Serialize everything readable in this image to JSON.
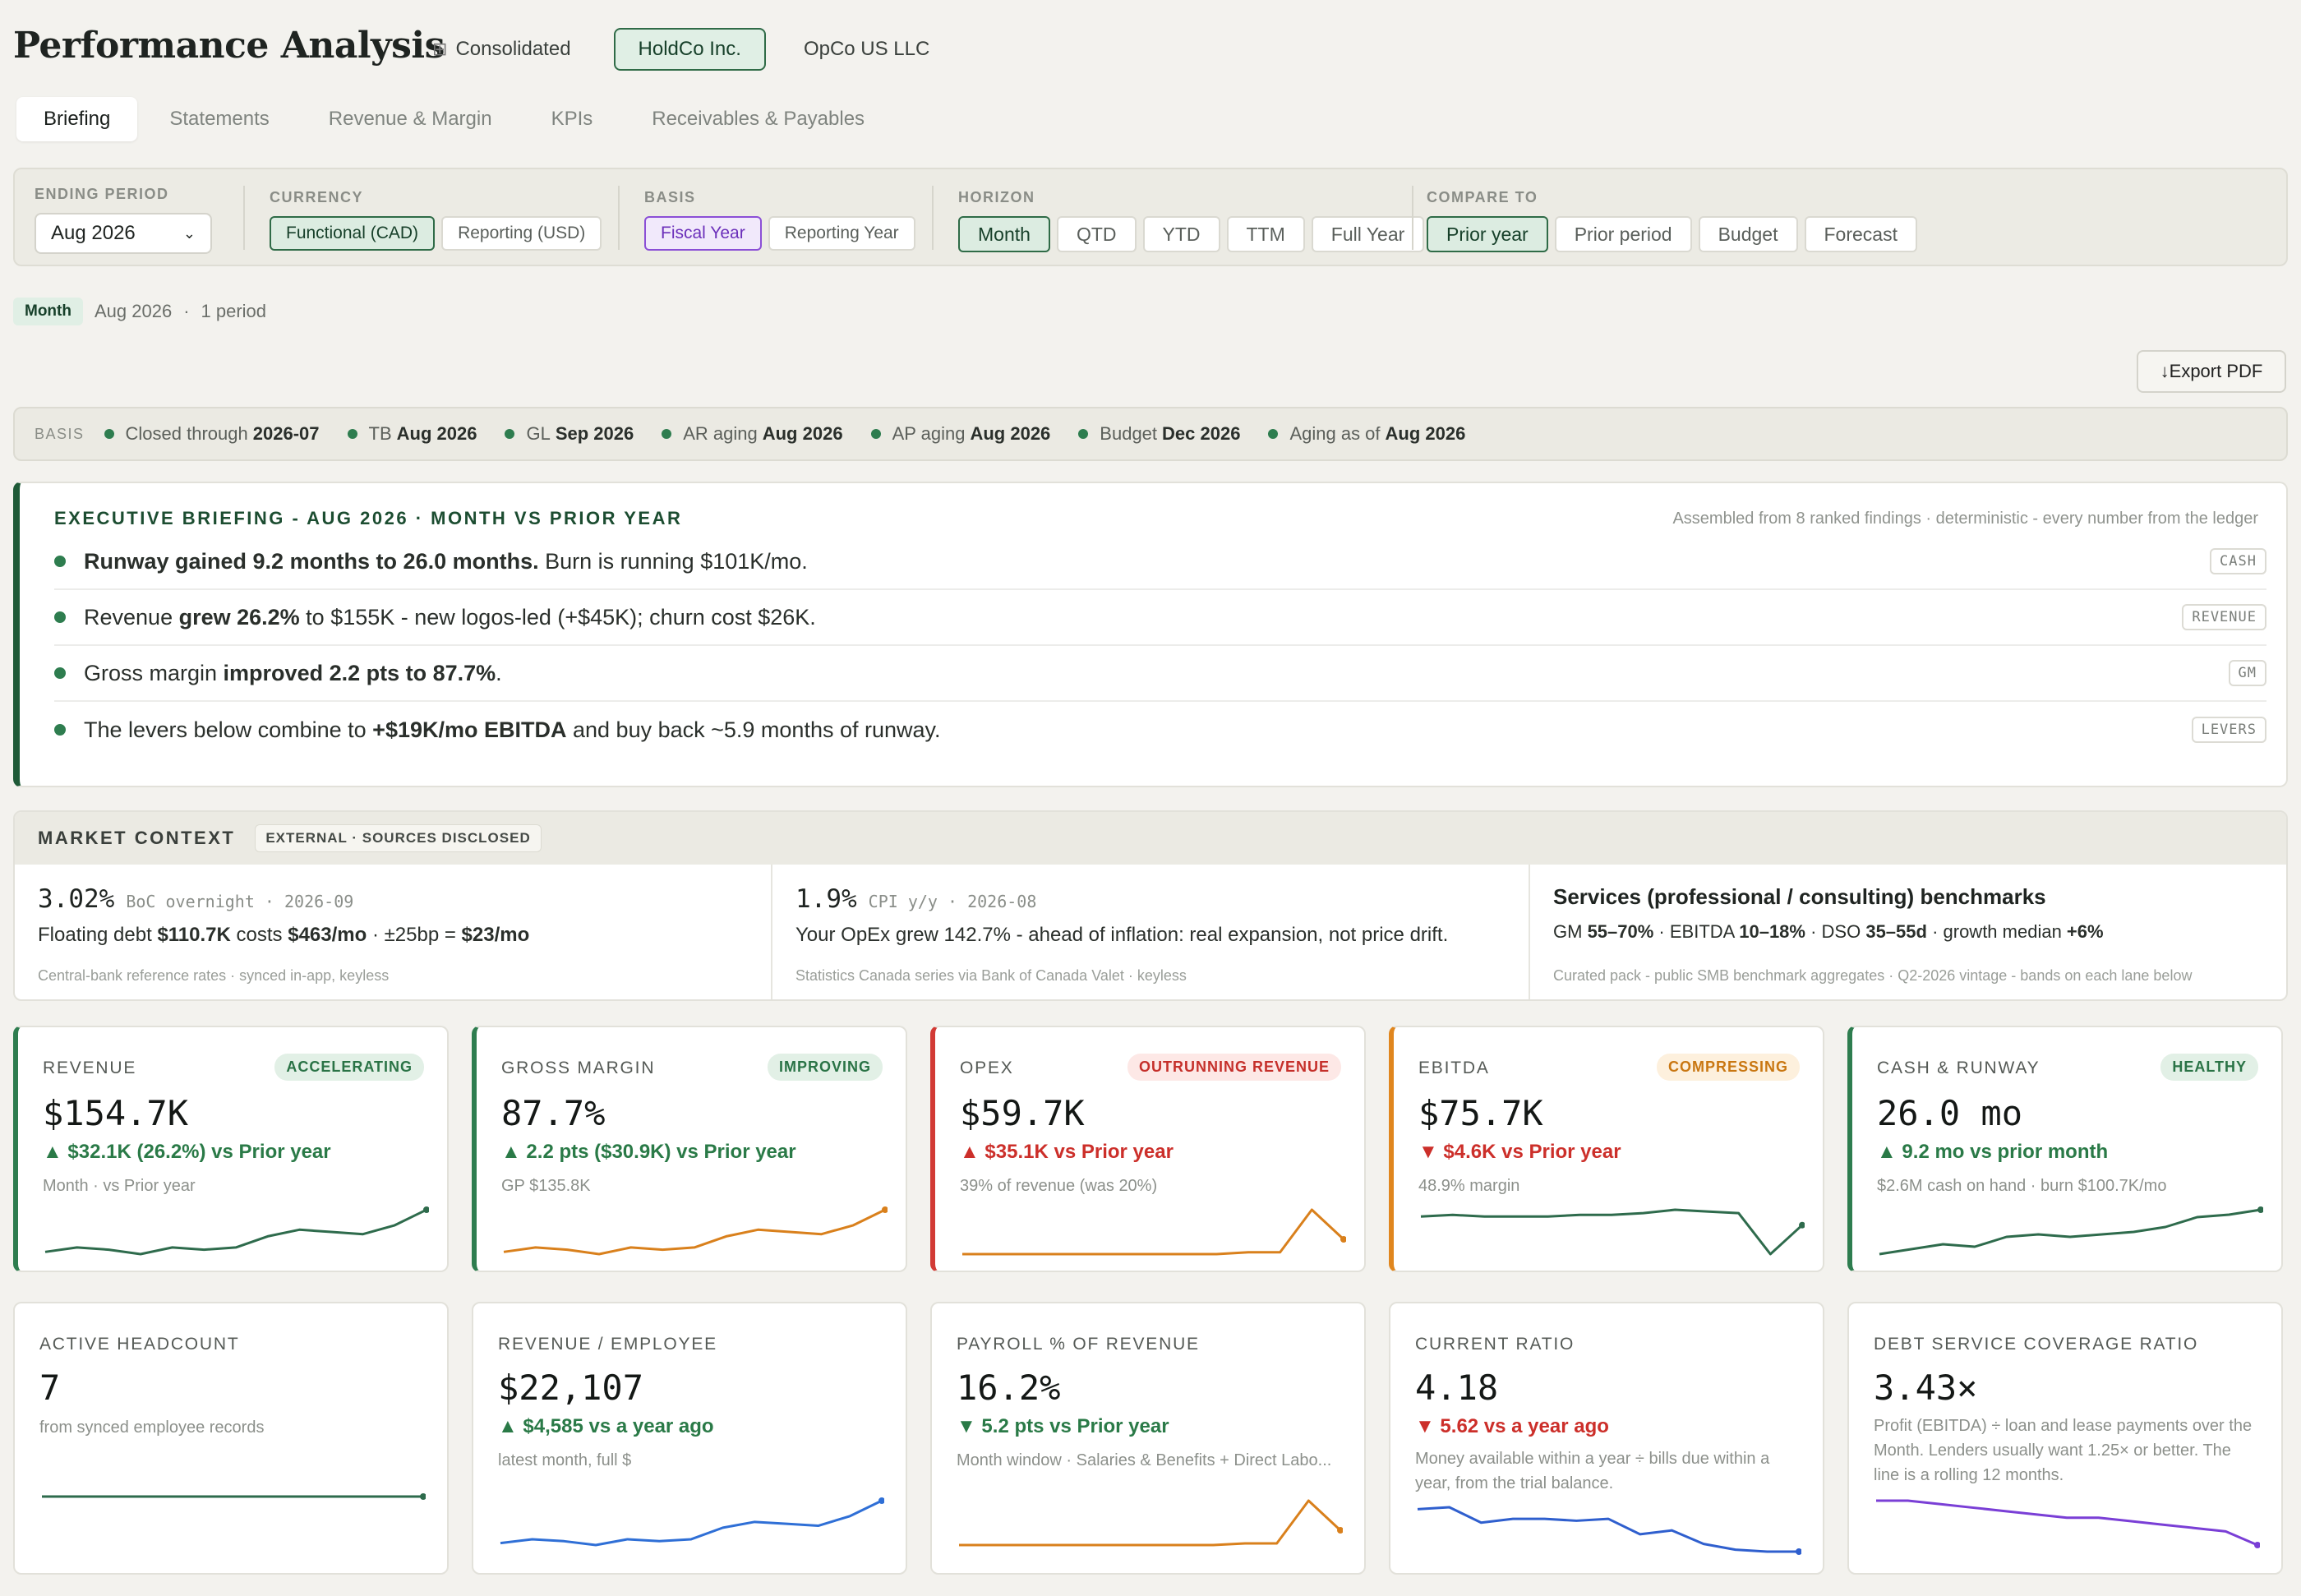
{
  "header": {
    "title": "Performance Analysis",
    "entities": [
      "Consolidated",
      "HoldCo Inc.",
      "OpCo US LLC"
    ]
  },
  "tabs": [
    "Briefing",
    "Statements",
    "Revenue & Margin",
    "KPIs",
    "Receivables & Payables"
  ],
  "filters": {
    "ending_period_label": "ENDING PERIOD",
    "ending_period_value": "Aug 2026",
    "currency_label": "CURRENCY",
    "currency_options": [
      "Functional (CAD)",
      "Reporting (USD)"
    ],
    "basis_label": "BASIS",
    "basis_options": [
      "Fiscal Year",
      "Reporting Year"
    ],
    "horizon_label": "HORIZON",
    "horizon_options": [
      "Month",
      "QTD",
      "YTD",
      "TTM",
      "Full Year"
    ],
    "compare_label": "COMPARE TO",
    "compare_options": [
      "Prior year",
      "Prior period",
      "Budget",
      "Forecast"
    ]
  },
  "period": {
    "chip": "Month",
    "range": "Aug 2026",
    "sep": "·",
    "count": "1 period"
  },
  "export_label": "↓Export PDF",
  "basis_strip": {
    "label": "BASIS",
    "items": [
      {
        "pre": "Closed through",
        "val": "2026-07"
      },
      {
        "pre": "TB",
        "val": "Aug 2026"
      },
      {
        "pre": "GL",
        "val": "Sep 2026"
      },
      {
        "pre": "AR aging",
        "val": "Aug 2026"
      },
      {
        "pre": "AP aging",
        "val": "Aug 2026"
      },
      {
        "pre": "Budget",
        "val": "Dec 2026"
      },
      {
        "pre": "Aging as of",
        "val": "Aug 2026"
      }
    ]
  },
  "briefing": {
    "title": "EXECUTIVE BRIEFING - AUG 2026 · MONTH VS PRIOR YEAR",
    "note": "Assembled from 8 ranked findings · deterministic - every number from the ledger",
    "findings": [
      {
        "b1": "Runway gained 9.2 months to 26.0 months.",
        "t1": " Burn is running $101K/mo.",
        "b2": "",
        "t2": "",
        "tag": "CASH"
      },
      {
        "b1": "",
        "t1": "Revenue ",
        "b2": "grew 26.2%",
        "t2": " to $155K - new logos-led (+$45K); churn cost $26K.",
        "tag": "REVENUE"
      },
      {
        "b1": "",
        "t1": "Gross margin ",
        "b2": "improved 2.2 pts to 87.7%",
        "t2": ".",
        "tag": "GM"
      },
      {
        "b1": "",
        "t1": "The levers below combine to ",
        "b2": "+$19K/mo EBITDA",
        "t2": " and buy back ~5.9 months of runway.",
        "tag": "LEVERS"
      }
    ]
  },
  "market": {
    "title": "MARKET CONTEXT",
    "badge": "EXTERNAL · SOURCES DISCLOSED",
    "col1": {
      "value": "3.02%",
      "meta": "BoC overnight · 2026-09",
      "l1": "Floating debt ",
      "l1b": "$110.7K",
      "l2": " costs ",
      "l2b": "$463/mo",
      "l3": " · ±25bp = ",
      "l3b": "$23/mo",
      "src": "Central-bank reference rates · synced in-app, keyless"
    },
    "col2": {
      "value": "1.9%",
      "meta": "CPI y/y · 2026-08",
      "line": "Your OpEx grew 142.7% - ahead of inflation: real expansion, not price drift.",
      "src": "Statistics Canada series via Bank of Canada Valet · keyless"
    },
    "col3": {
      "title": "Services (professional / consulting) benchmarks",
      "p1": "GM ",
      "p1b": "55–70%",
      "p2": " · EBITDA ",
      "p2b": "10–18%",
      "p3": " · DSO ",
      "p3b": "35–55d",
      "p4": " · growth median ",
      "p4b": "+6%",
      "src": "Curated pack - public SMB benchmark aggregates · Q2-2026 vintage - bands on each lane below"
    }
  },
  "kpis_row1": [
    {
      "title": "REVENUE",
      "badge": "ACCELERATING",
      "value": "$154.7K",
      "delta": "▲ $32.1K (26.2%) vs Prior year",
      "sub": "Month · vs Prior year",
      "color": "#2e6b4c",
      "spark": [
        3,
        5,
        4,
        2,
        5,
        4,
        5,
        10,
        13,
        12,
        11,
        15,
        22
      ]
    },
    {
      "title": "GROSS MARGIN",
      "badge": "IMPROVING",
      "value": "87.7%",
      "delta": "▲ 2.2 pts ($30.9K) vs Prior year",
      "sub": "GP $135.8K",
      "color": "#d9801c",
      "spark": [
        3,
        5,
        4,
        2,
        5,
        4,
        5,
        10,
        13,
        12,
        11,
        15,
        22
      ]
    },
    {
      "title": "OPEX",
      "badge": "OUTRUNNING REVENUE",
      "value": "$59.7K",
      "delta": "▲ $35.1K vs Prior year",
      "sub": "39% of revenue (was 20%)",
      "color": "#d9801c",
      "spark": [
        2,
        2,
        2,
        2,
        2,
        2,
        2,
        2,
        2,
        3,
        3,
        26,
        10
      ]
    },
    {
      "title": "EBITDA",
      "badge": "COMPRESSING",
      "value": "$75.7K",
      "delta": "▼ $4.6K vs Prior year",
      "sub": "48.9% margin",
      "color": "#2e6b4c",
      "spark": [
        30,
        31,
        30,
        30,
        30,
        31,
        31,
        32,
        34,
        33,
        32,
        8,
        25
      ]
    },
    {
      "title": "CASH & RUNWAY",
      "badge": "HEALTHY",
      "value": "26.0 mo",
      "delta": "▲ 9.2 mo vs prior month",
      "sub": "$2.6M cash on hand · burn $100.7K/mo",
      "color": "#2e6b4c",
      "spark": [
        3,
        5,
        7,
        6,
        10,
        11,
        10,
        11,
        12,
        14,
        18,
        19,
        21
      ]
    }
  ],
  "kpis_row2": [
    {
      "title": "ACTIVE HEADCOUNT",
      "value": "7",
      "delta": "",
      "sub": "from synced employee records",
      "color": "#2e6b4c",
      "spark": [
        10,
        10,
        10,
        10,
        10,
        10,
        10,
        10,
        10,
        10,
        10,
        10,
        10
      ]
    },
    {
      "title": "REVENUE / EMPLOYEE",
      "value": "$22,107",
      "delta": "▲ $4,585 vs a year ago",
      "sub": "latest month, full $",
      "color": "#2f6fd6",
      "spark": [
        4,
        6,
        5,
        3,
        6,
        5,
        6,
        12,
        15,
        14,
        13,
        18,
        26
      ]
    },
    {
      "title": "PAYROLL % OF REVENUE",
      "value": "16.2%",
      "delta": "▼ 5.2 pts vs Prior year",
      "sub": "Month window · Salaries & Benefits + Direct Labo...",
      "color": "#d9801c",
      "spark": [
        3,
        3,
        3,
        3,
        3,
        3,
        3,
        3,
        3,
        4,
        4,
        30,
        12
      ]
    },
    {
      "title": "CURRENT RATIO",
      "value": "4.18",
      "delta": "▼ 5.62 vs a year ago",
      "sub": "Money available within a year ÷ bills due within a year, from the trial balance.",
      "color": "#2f5fce",
      "spark": [
        40,
        41,
        33,
        35,
        35,
        34,
        35,
        27,
        29,
        22,
        19,
        18,
        18
      ]
    },
    {
      "title": "DEBT SERVICE COVERAGE RATIO",
      "value": "3.43×",
      "delta": "",
      "sub": "Profit (EBITDA) ÷ loan and lease payments over the Month. Lenders usually want 1.25× or better. The line is a rolling 12 months.",
      "color": "#7a3fd6",
      "spark": [
        40,
        40,
        39,
        38,
        37,
        36,
        35,
        35,
        34,
        33,
        32,
        31,
        27
      ]
    }
  ]
}
